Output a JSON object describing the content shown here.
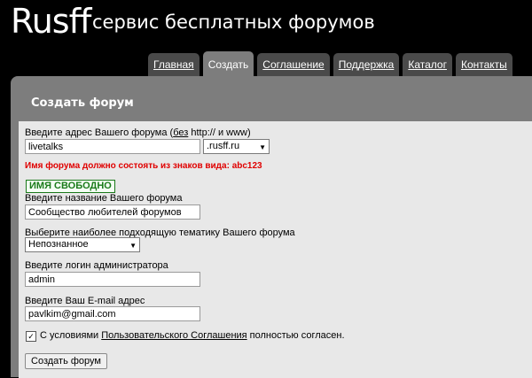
{
  "header": {
    "logo": "Rusff",
    "tagline": "сервис бесплатных форумов"
  },
  "nav": {
    "tabs": [
      {
        "label": "Главная"
      },
      {
        "label": "Создать"
      },
      {
        "label": "Соглашение"
      },
      {
        "label": "Поддержка"
      },
      {
        "label": "Каталог"
      },
      {
        "label": "Контакты"
      }
    ],
    "active": "Создать"
  },
  "form": {
    "heading": "Создать форум",
    "address_label_pre": "Введите адрес Вашего форума (",
    "address_label_link": "без",
    "address_label_post": " http:// и www)",
    "address_value": "livetalks",
    "domain_value": ".rusff.ru",
    "error_text": "Имя форума должно состоять из знаков вида: abc123",
    "availability_badge": "ИМЯ СВОБОДНО",
    "name_label": "Введите название Вашего форума",
    "name_value": "Сообщество любителей форумов",
    "topic_label": "Выберите наиболее подходящую тематику Вашего форума",
    "topic_value": "Непознанное",
    "login_label": "Введите логин администратора",
    "login_value": "admin",
    "email_label": "Введите Ваш E-mail адрес",
    "email_value": "pavlkim@gmail.com",
    "agree_checked": true,
    "agree_pre": "С условиями ",
    "agree_link": "Пользовательского Соглашения",
    "agree_post": " полностью согласен.",
    "submit_label": "Создать форум"
  }
}
